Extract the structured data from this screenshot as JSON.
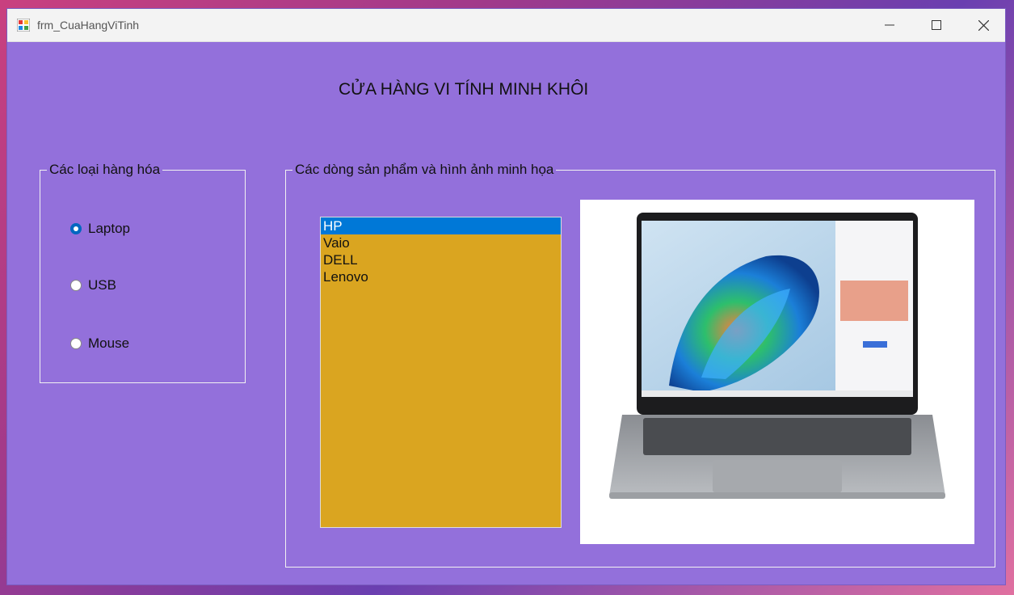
{
  "window": {
    "title": "frm_CuaHangViTinh",
    "controls": {
      "minimize": "minimize",
      "maximize": "maximize",
      "close": "close"
    }
  },
  "heading": "CỬA HÀNG VI TÍNH MINH KHÔI",
  "category_group": {
    "label": "Các loại hàng hóa",
    "options": [
      {
        "label": "Laptop",
        "checked": true
      },
      {
        "label": "USB",
        "checked": false
      },
      {
        "label": "Mouse",
        "checked": false
      }
    ]
  },
  "product_group": {
    "label": "Các dòng sản phẩm và hình ảnh minh họa",
    "list": {
      "items": [
        "HP",
        "Vaio",
        "DELL",
        "Lenovo"
      ],
      "selected": "HP",
      "background": "#DAA520",
      "selection_color": "#0078D7"
    },
    "picture": {
      "icon": "laptop-image"
    }
  },
  "colors": {
    "form_background": "#9370DB",
    "titlebar": "#F3F3F3"
  }
}
